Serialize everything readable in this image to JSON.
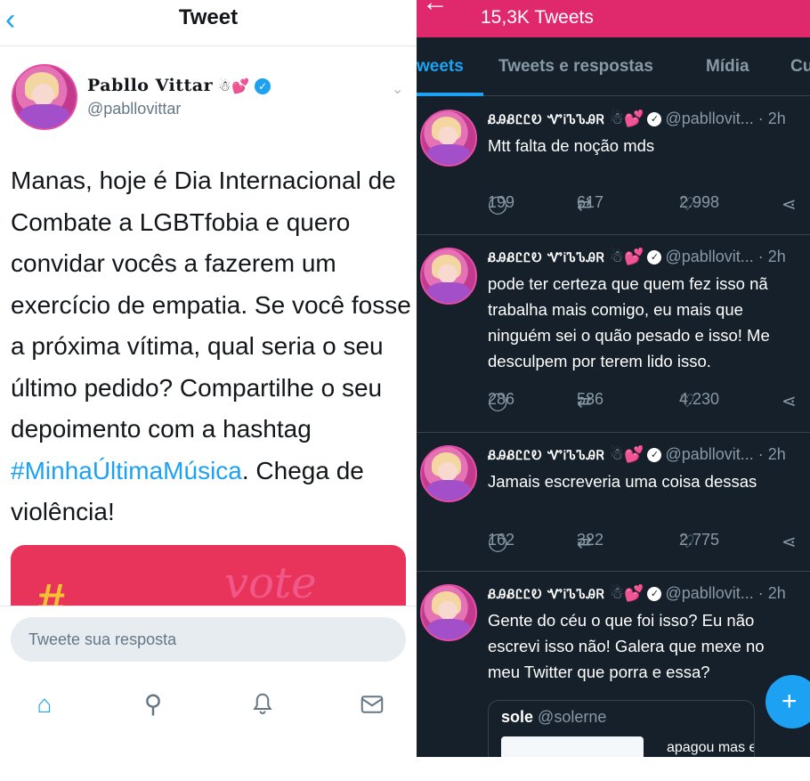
{
  "left": {
    "header": {
      "back_glyph": "‹",
      "title": "Tweet"
    },
    "author": {
      "name": "Pabllo Vittar",
      "emoji": "☃💕",
      "verified_glyph": "✓",
      "handle": "@pabllovittar"
    },
    "chevron": "⌄",
    "body_before": "Manas, hoje é Dia Internacional de Combate a LGBTfobia e quero convidar vocês a fazerem um exercício de empatia. Se você fosse a próxima vítima, qual seria o seu último pedido? Compartilhe o seu depoimento com a hashtag ",
    "hashtag": "#MinhaÚltimaMúsica",
    "body_after": ". Chega de violência!",
    "media": {
      "glyph": "#",
      "scribble": "vote"
    },
    "reply_placeholder": "Tweete sua resposta",
    "nav": {
      "home_icon": "⌂",
      "search_icon": "⚲",
      "notif_icon": "♪",
      "mail_icon": "✉"
    }
  },
  "right": {
    "header": {
      "back_glyph": "←",
      "count": "15,3K Tweets"
    },
    "tabs": [
      "weets",
      "Tweets e respostas",
      "Mídia",
      "Cu"
    ],
    "tweets": [
      {
        "fancy_name": "ᏰᎯᏰᏝᏝᎧ ᏉᎥᏖᏖᎯᏒ",
        "emoji": "☃💕",
        "handle": "@pabllovit...",
        "time": "· 2h",
        "lines": [
          "Mtt falta de noção mds"
        ],
        "replies": "199",
        "retweets": "617",
        "likes": "2.998"
      },
      {
        "fancy_name": "ᏰᎯᏰᏝᏝᎧ ᏉᎥᏖᏖᎯᏒ",
        "emoji": "☃💕",
        "handle": "@pabllovit...",
        "time": "· 2h",
        "lines": [
          "pode ter certeza que quem fez isso nã",
          "trabalha mais comigo, eu mais que",
          "ninguém sei o quão pesado e isso! Me",
          "desculpem por terem lido isso."
        ],
        "replies": "286",
        "retweets": "536",
        "likes": "4.230"
      },
      {
        "fancy_name": "ᏰᎯᏰᏝᏝᎧ ᏉᎥᏖᏖᎯᏒ",
        "emoji": "☃💕",
        "handle": "@pabllovit...",
        "time": "· 2h",
        "lines": [
          "Jamais escreveria uma coisa dessas"
        ],
        "replies": "162",
        "retweets": "322",
        "likes": "2.775"
      },
      {
        "fancy_name": "ᏰᎯᏰᏝᏝᎧ ᏉᎥᏖᏖᎯᏒ",
        "emoji": "☃💕",
        "handle": "@pabllovit...",
        "time": "· 2h",
        "lines": [
          "Gente do céu o que foi isso? Eu não",
          "escrevi isso não! Galera que mexe no",
          "meu Twitter que porra e essa?"
        ]
      }
    ],
    "quote": {
      "name": "sole",
      "handle": "@solerne",
      "text": "apagou mas eu"
    },
    "icons": {
      "reply": "◯",
      "retweet": "⇄",
      "like": "♡",
      "share": "⋖",
      "fab": "+"
    }
  }
}
